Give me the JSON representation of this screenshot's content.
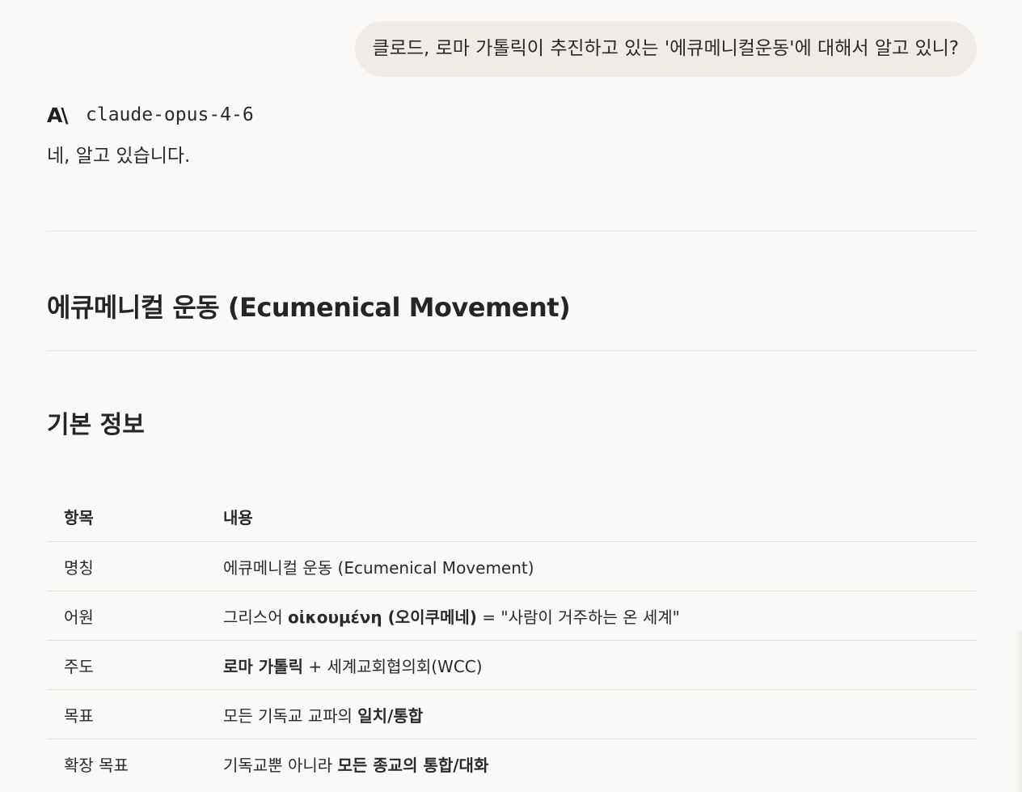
{
  "user_message": "클로드, 로마 가톨릭이 추진하고 있는 '에큐메니컬운동'에 대해서 알고 있니?",
  "assistant": {
    "brand_icon": "A\\",
    "model_name": "claude-opus-4-6",
    "intro": "네, 알고 있습니다.",
    "heading": "에큐메니컬 운동 (Ecumenical Movement)",
    "subheading": "기본 정보",
    "table": {
      "headers": [
        "항목",
        "내용"
      ],
      "rows": [
        {
          "label": "명칭",
          "parts": [
            {
              "text": "에큐메니컬 운동 (Ecumenical Movement)",
              "bold": false
            }
          ]
        },
        {
          "label": "어원",
          "parts": [
            {
              "text": "그리스어 ",
              "bold": false
            },
            {
              "text": "οἰκουμένη (오이쿠메네)",
              "bold": true
            },
            {
              "text": " = \"사람이 거주하는 온 세계\"",
              "bold": false
            }
          ]
        },
        {
          "label": "주도",
          "parts": [
            {
              "text": "로마 가톨릭",
              "bold": true
            },
            {
              "text": " + 세계교회협의회(WCC)",
              "bold": false
            }
          ]
        },
        {
          "label": "목표",
          "parts": [
            {
              "text": "모든 기독교 교파의 ",
              "bold": false
            },
            {
              "text": "일치/통합",
              "bold": true
            }
          ]
        },
        {
          "label": "확장 목표",
          "parts": [
            {
              "text": "기독교뿐 아니라 ",
              "bold": false
            },
            {
              "text": "모든 종교의 통합/대화",
              "bold": true
            }
          ]
        }
      ]
    }
  }
}
